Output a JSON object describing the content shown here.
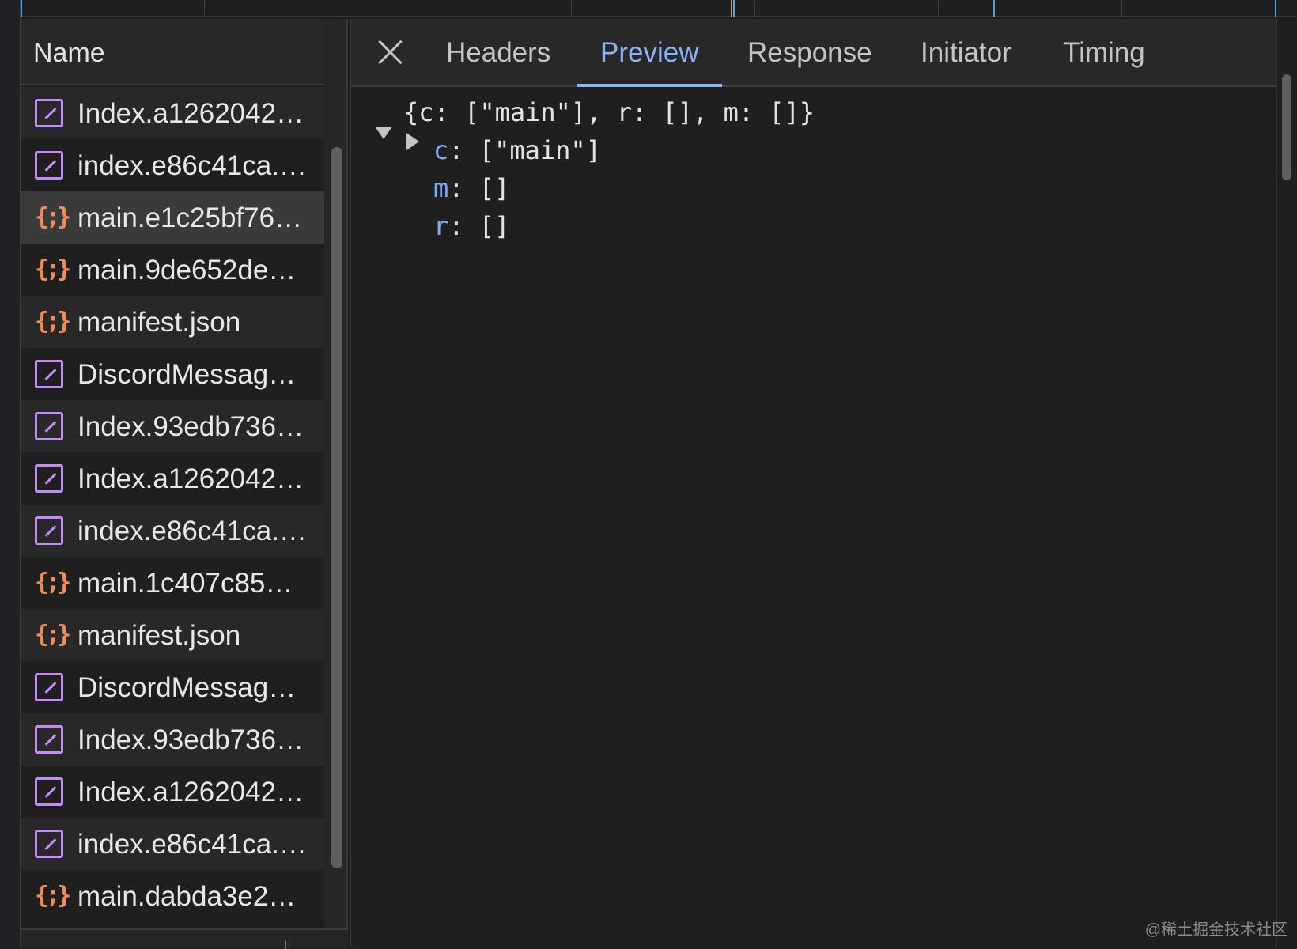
{
  "name_column": {
    "header": "Name",
    "rows": [
      {
        "icon": "image-icon",
        "name": "Index.a1262042…",
        "selected": false
      },
      {
        "icon": "image-icon",
        "name": "index.e86c41ca.…",
        "selected": false
      },
      {
        "icon": "json-icon",
        "name": "main.e1c25bf76…",
        "selected": true
      },
      {
        "icon": "json-icon",
        "name": "main.9de652de…",
        "selected": false
      },
      {
        "icon": "json-icon",
        "name": "manifest.json",
        "selected": false
      },
      {
        "icon": "image-icon",
        "name": "DiscordMessag…",
        "selected": false
      },
      {
        "icon": "image-icon",
        "name": "Index.93edb736…",
        "selected": false
      },
      {
        "icon": "image-icon",
        "name": "Index.a1262042…",
        "selected": false
      },
      {
        "icon": "image-icon",
        "name": "index.e86c41ca.…",
        "selected": false
      },
      {
        "icon": "json-icon",
        "name": "main.1c407c85…",
        "selected": false
      },
      {
        "icon": "json-icon",
        "name": "manifest.json",
        "selected": false
      },
      {
        "icon": "image-icon",
        "name": "DiscordMessag…",
        "selected": false
      },
      {
        "icon": "image-icon",
        "name": "Index.93edb736…",
        "selected": false
      },
      {
        "icon": "image-icon",
        "name": "Index.a1262042…",
        "selected": false
      },
      {
        "icon": "image-icon",
        "name": "index.e86c41ca.…",
        "selected": false
      },
      {
        "icon": "json-icon",
        "name": "main.dabda3e2…",
        "selected": false
      }
    ]
  },
  "tabs": {
    "headers": "Headers",
    "preview": "Preview",
    "response": "Response",
    "initiator": "Initiator",
    "timing": "Timing",
    "active": "Preview"
  },
  "preview": {
    "root": "{c: [\"main\"], r: [], m: []}",
    "c_key": "c",
    "c_value": "[\"main\"]",
    "m_key": "m",
    "m_value": "[]",
    "r_key": "r",
    "r_value": "[]",
    "sep": ":"
  },
  "icons": {
    "image": "image-icon",
    "json": "json-icon",
    "json_glyph": "{;}",
    "close": "close-icon",
    "expand_down": "triangle-down-icon",
    "collapsed_right": "triangle-right-icon"
  },
  "colors": {
    "accent": "#8ab4f8",
    "image_icon": "#c58af9",
    "json_icon": "#f28b54",
    "key": "#7cacf8",
    "timeline_blue": "#4fa3e0",
    "timeline_orange": "#e8833a"
  },
  "watermark": "@稀土掘金技术社区"
}
